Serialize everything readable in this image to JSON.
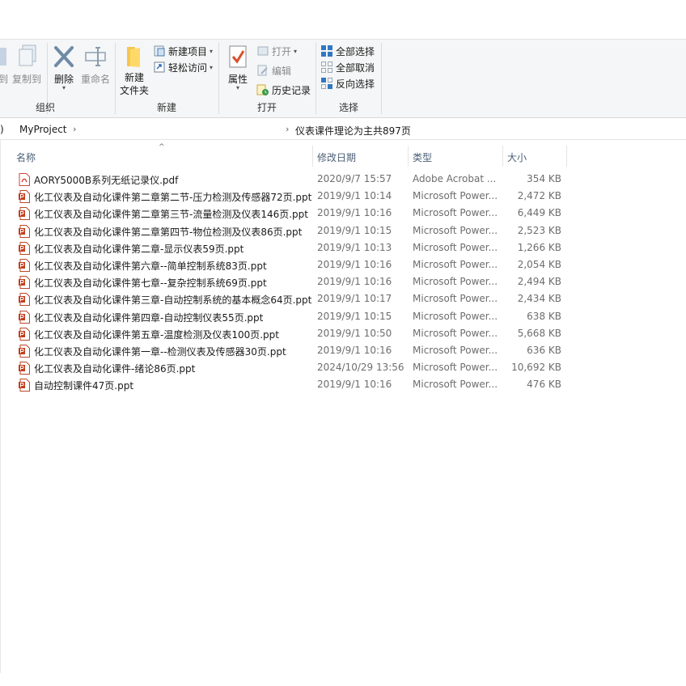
{
  "ribbon": {
    "org": {
      "label": "组织",
      "move_to": "到",
      "copy_to": "复制到",
      "delete": "删除",
      "rename": "重命名"
    },
    "new": {
      "label": "新建",
      "new_folder_line1": "新建",
      "new_folder_line2": "文件夹",
      "new_item": "新建项目",
      "easy_access": "轻松访问"
    },
    "open": {
      "label": "打开",
      "properties": "属性",
      "open": "打开",
      "edit": "编辑",
      "history": "历史记录"
    },
    "select": {
      "label": "选择",
      "select_all": "全部选择",
      "select_none": "全部取消",
      "invert": "反向选择"
    }
  },
  "address": {
    "partial": ")",
    "crumb1": "MyProject",
    "crumb2": "仪表课件理论为主共897页"
  },
  "columns": {
    "name": "名称",
    "date": "修改日期",
    "type": "类型",
    "size": "大小"
  },
  "colors": {
    "pdf": "#d93025",
    "ppt": "#c43e1c",
    "select_blue": "#1e6fc7"
  },
  "files": [
    {
      "name": "AORY5000B系列无纸记录仪.pdf",
      "date": "2020/9/7 15:57",
      "type": "Adobe Acrobat ...",
      "size": "354 KB",
      "icon": "pdf"
    },
    {
      "name": "化工仪表及自动化课件第二章第二节-压力检测及传感器72页.ppt",
      "date": "2019/9/1 10:14",
      "type": "Microsoft Power...",
      "size": "2,472 KB",
      "icon": "ppt"
    },
    {
      "name": "化工仪表及自动化课件第二章第三节-流量检测及仪表146页.ppt",
      "date": "2019/9/1 10:16",
      "type": "Microsoft Power...",
      "size": "6,449 KB",
      "icon": "ppt"
    },
    {
      "name": "化工仪表及自动化课件第二章第四节-物位检测及仪表86页.ppt",
      "date": "2019/9/1 10:15",
      "type": "Microsoft Power...",
      "size": "2,523 KB",
      "icon": "ppt"
    },
    {
      "name": "化工仪表及自动化课件第二章-显示仪表59页.ppt",
      "date": "2019/9/1 10:13",
      "type": "Microsoft Power...",
      "size": "1,266 KB",
      "icon": "ppt"
    },
    {
      "name": "化工仪表及自动化课件第六章--简单控制系统83页.ppt",
      "date": "2019/9/1 10:16",
      "type": "Microsoft Power...",
      "size": "2,054 KB",
      "icon": "ppt"
    },
    {
      "name": "化工仪表及自动化课件第七章--复杂控制系统69页.ppt",
      "date": "2019/9/1 10:16",
      "type": "Microsoft Power...",
      "size": "2,494 KB",
      "icon": "ppt"
    },
    {
      "name": "化工仪表及自动化课件第三章-自动控制系统的基本概念64页.ppt",
      "date": "2019/9/1 10:17",
      "type": "Microsoft Power...",
      "size": "2,434 KB",
      "icon": "ppt"
    },
    {
      "name": "化工仪表及自动化课件第四章-自动控制仪表55页.ppt",
      "date": "2019/9/1 10:15",
      "type": "Microsoft Power...",
      "size": "638 KB",
      "icon": "ppt"
    },
    {
      "name": "化工仪表及自动化课件第五章-温度检测及仪表100页.ppt",
      "date": "2019/9/1 10:50",
      "type": "Microsoft Power...",
      "size": "5,668 KB",
      "icon": "ppt"
    },
    {
      "name": "化工仪表及自动化课件第一章--检测仪表及传感器30页.ppt",
      "date": "2019/9/1 10:16",
      "type": "Microsoft Power...",
      "size": "636 KB",
      "icon": "ppt"
    },
    {
      "name": "化工仪表及自动化课件-绪论86页.ppt",
      "date": "2024/10/29 13:56",
      "type": "Microsoft Power...",
      "size": "10,692 KB",
      "icon": "ppt"
    },
    {
      "name": "自动控制课件47页.ppt",
      "date": "2019/9/1 10:16",
      "type": "Microsoft Power...",
      "size": "476 KB",
      "icon": "ppt"
    }
  ]
}
